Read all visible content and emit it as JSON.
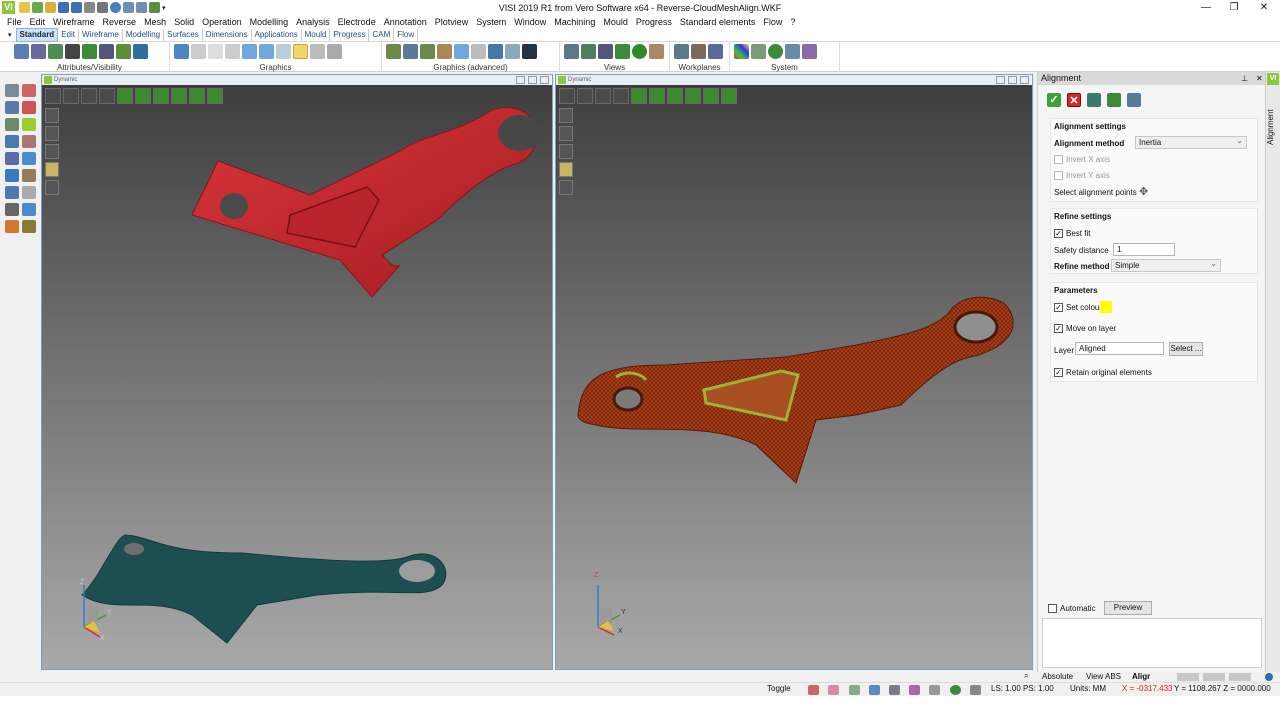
{
  "window": {
    "title": "VISI 2019 R1 from Vero Software x64 - Reverse-CloudMeshAlign.WKF",
    "logo": "VI",
    "minimize": "—",
    "restore": "❐",
    "close": "✕"
  },
  "menu": [
    "File",
    "Edit",
    "Wireframe",
    "Reverse",
    "Mesh",
    "Solid",
    "Operation",
    "Modelling",
    "Analysis",
    "Electrode",
    "Annotation",
    "Plotview",
    "System",
    "Window",
    "Machining",
    "Mould",
    "Progress",
    "Standard elements",
    "Flow",
    "?"
  ],
  "ribbon_tabs": [
    "Standard",
    "Edit",
    "Wireframe",
    "Modelling",
    "Surfaces",
    "Dimensions",
    "Applications",
    "Mould",
    "Progress",
    "CAM",
    "Flow"
  ],
  "ribbon_groups": [
    "Attributes/Visibility",
    "Graphics",
    "Graphics (advanced)",
    "Views",
    "Workplanes",
    "System"
  ],
  "viewports": [
    {
      "title": "Dynamic"
    },
    {
      "title": "Dynamic"
    }
  ],
  "axes": {
    "x": "X",
    "y": "Y",
    "z": "Z"
  },
  "panel": {
    "title": "Alignment",
    "side_tab": "Alignment",
    "alignment_settings": {
      "heading": "Alignment settings",
      "method_label": "Alignment method",
      "method_value": "Inertia",
      "invert_x": "Invert X axis",
      "invert_y": "Invert Y axis",
      "select_points": "Select alignment points"
    },
    "refine_settings": {
      "heading": "Refine settings",
      "best_fit": "Best fit",
      "safety_label": "Safety distance",
      "safety_value": "1",
      "refine_label": "Refine method",
      "refine_value": "Simple"
    },
    "parameters": {
      "heading": "Parameters",
      "set_colour": "Set colour",
      "colour": "#ffff00",
      "move_on_layer": "Move on layer",
      "layer_label": "Layer",
      "layer_value": "Aligned",
      "select_button": "Select ...",
      "retain": "Retain original elements"
    },
    "automatic": "Automatic",
    "preview": "Preview"
  },
  "status": {
    "absolute": "Absolute",
    "view": "View ABS",
    "align": "Aligr",
    "toggle": "Toggle",
    "ls_ps": "LS: 1.00 PS: 1.00",
    "units": "Units: MM",
    "x_coord": "X = -0317.433",
    "yz_coord": "Y = 1108.267 Z = 0000.000"
  },
  "colors": {
    "accent": "#8cc63f",
    "part_red": "#c8262a",
    "mesh_teal": "#1d4f52",
    "mesh_orange": "#b5441c",
    "highlight_green": "#9cb33a"
  }
}
